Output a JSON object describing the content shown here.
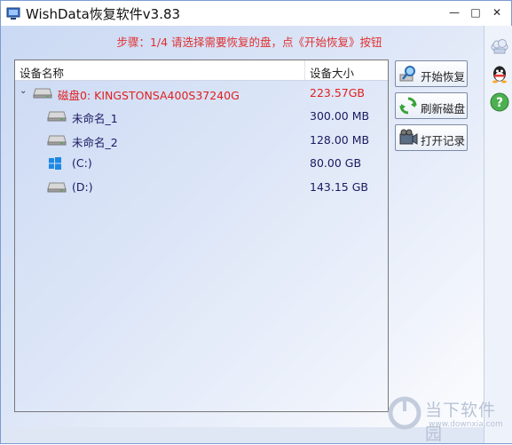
{
  "window": {
    "title": "WishData恢复软件v3.83",
    "controls": {
      "minimize": "—",
      "maximize": "□",
      "close": "✕"
    }
  },
  "step": {
    "text": "步骤：1/4 请选择需要恢复的盘，点《开始恢复》按钮"
  },
  "device_list": {
    "columns": {
      "name": "设备名称",
      "size": "设备大小"
    },
    "rows": [
      {
        "type": "disk",
        "expander": "⌄",
        "icon": "hdd-icon",
        "name": "磁盘0: KINGSTONSA400S37240G",
        "size": "223.57GB"
      },
      {
        "type": "part",
        "icon": "hdd-icon",
        "name": "未命名_1",
        "size": "300.00 MB"
      },
      {
        "type": "part",
        "icon": "hdd-icon",
        "name": "未命名_2",
        "size": "128.00 MB"
      },
      {
        "type": "part",
        "icon": "windows-icon",
        "name": "(C:)",
        "size": "80.00 GB"
      },
      {
        "type": "part",
        "icon": "hdd-icon",
        "name": "(D:)",
        "size": "143.15 GB"
      }
    ]
  },
  "actions": {
    "start_recovery": "开始恢复",
    "refresh_disks": "刷新磁盘",
    "open_records": "打开记录"
  },
  "side_icons": [
    "cloud-icon",
    "qq-icon",
    "help-icon"
  ],
  "watermark": {
    "main": "当下软件园",
    "sub": "www.downxia.com"
  },
  "colors": {
    "accent_red": "#e02020",
    "partition_text": "#1a1a60",
    "border": "#7d9bd1"
  }
}
